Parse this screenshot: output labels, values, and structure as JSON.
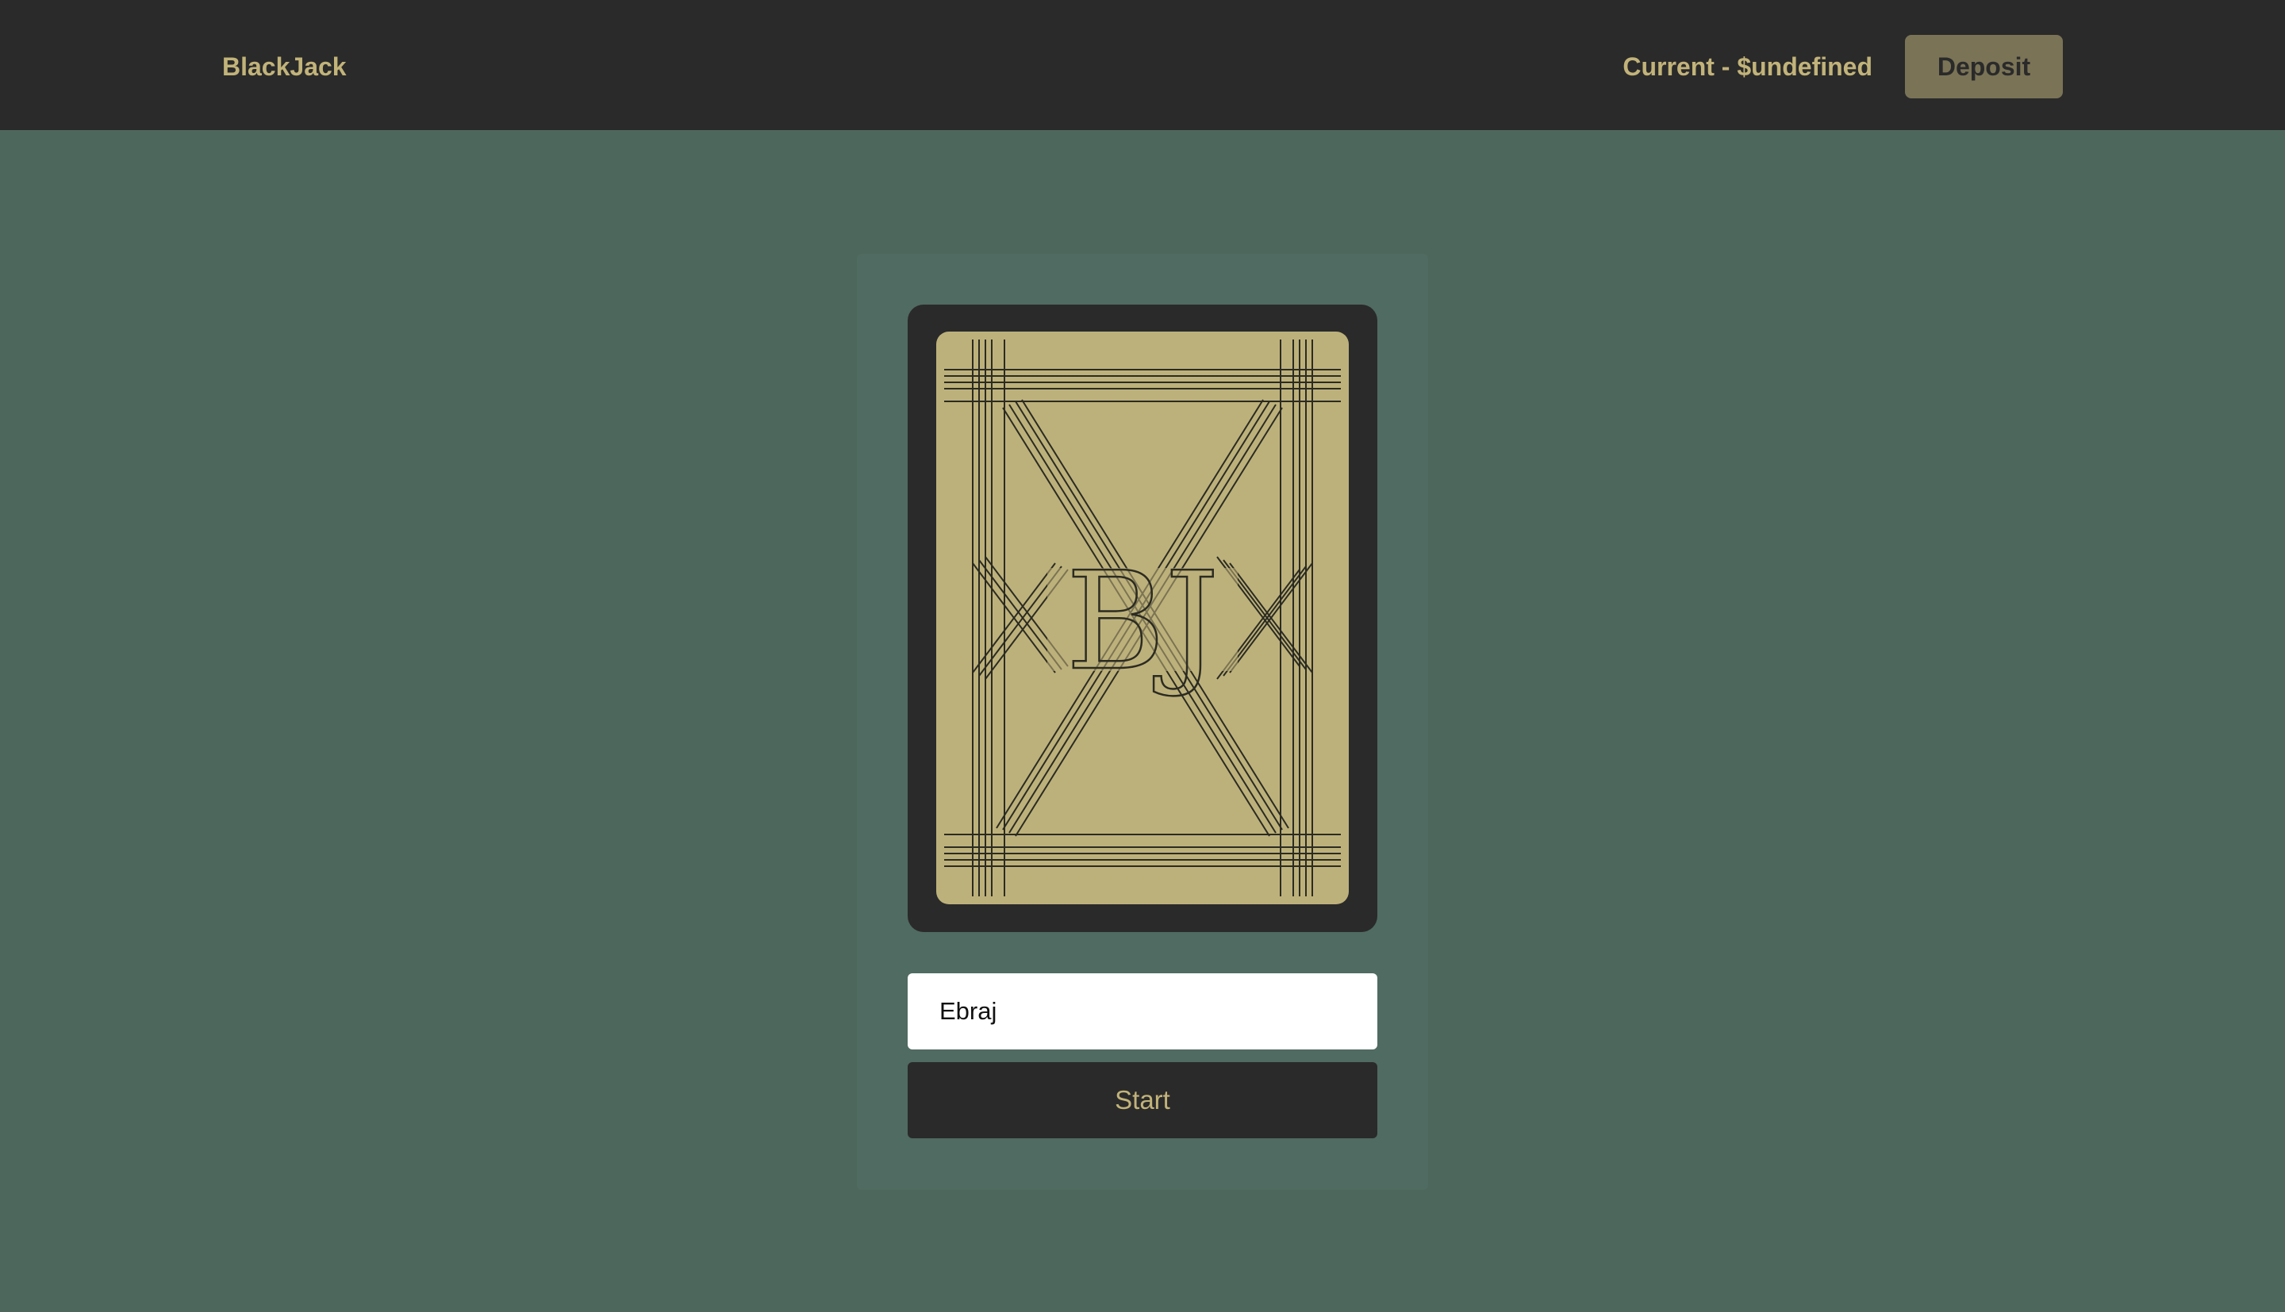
{
  "navbar": {
    "brand": "BlackJack",
    "balance_text": "Current - $undefined",
    "deposit_label": "Deposit"
  },
  "card": {
    "monogram": "BJ"
  },
  "form": {
    "name_value": "Ebraj",
    "name_placeholder": "",
    "start_label": "Start"
  },
  "colors": {
    "page_bg": "#4e675d",
    "navbar_bg": "#2a2a2a",
    "accent_gold": "#c2b37a",
    "card_gold": "#bdb17b",
    "deposit_bg": "#7a7356",
    "deposit_text": "#2a2a2a",
    "line": "#2b2b22"
  }
}
